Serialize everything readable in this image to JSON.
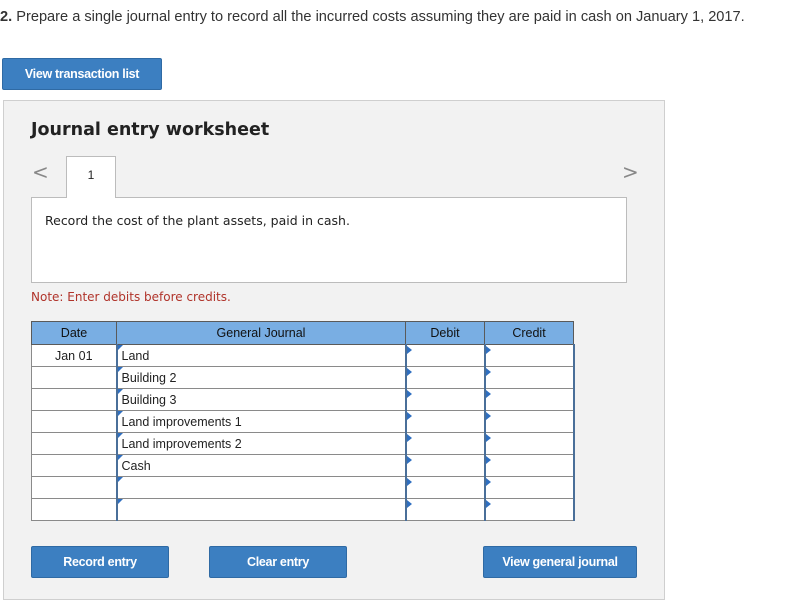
{
  "question": {
    "number": "2.",
    "text": "Prepare a single journal entry to record all the incurred costs assuming they are paid in cash on January 1, 2017."
  },
  "buttons": {
    "view_transaction_list": "View transaction list",
    "record_entry": "Record entry",
    "clear_entry": "Clear entry",
    "view_general_journal": "View general journal"
  },
  "worksheet": {
    "title": "Journal entry worksheet",
    "prev_arrow": "<",
    "next_arrow": ">",
    "tab_label": "1",
    "instruction": "Record the cost of the plant assets, paid in cash.",
    "note": "Note: Enter debits before credits."
  },
  "table": {
    "headers": {
      "date": "Date",
      "general_journal": "General Journal",
      "debit": "Debit",
      "credit": "Credit"
    },
    "rows": [
      {
        "date": "Jan 01",
        "account": "Land",
        "debit": "",
        "credit": ""
      },
      {
        "date": "",
        "account": "Building 2",
        "debit": "",
        "credit": ""
      },
      {
        "date": "",
        "account": "Building 3",
        "debit": "",
        "credit": ""
      },
      {
        "date": "",
        "account": "Land improvements 1",
        "debit": "",
        "credit": ""
      },
      {
        "date": "",
        "account": "Land improvements 2",
        "debit": "",
        "credit": ""
      },
      {
        "date": "",
        "account": "Cash",
        "debit": "",
        "credit": ""
      },
      {
        "date": "",
        "account": "",
        "debit": "",
        "credit": ""
      },
      {
        "date": "",
        "account": "",
        "debit": "",
        "credit": ""
      }
    ]
  },
  "colors": {
    "accent": "#3c7fc1",
    "table_header": "#79aee3",
    "note": "#b0332a"
  }
}
